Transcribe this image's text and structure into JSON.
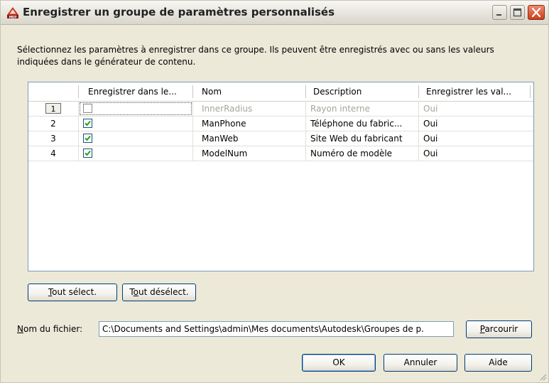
{
  "window": {
    "title": "Enregistrer un groupe de paramètres personnalisés",
    "app_icon": "autocad-mep-icon",
    "controls": [
      "minimize-icon",
      "maximize-icon",
      "close-icon"
    ]
  },
  "instructions": "Sélectionnez les paramètres à enregistrer dans ce groupe. Ils peuvent être enregistrés avec ou sans les valeurs indiquées dans le générateur de contenu.",
  "table": {
    "columns": [
      "",
      "Enregistrer dans le...",
      "Nom",
      "Description",
      "Enregistrer les val..."
    ],
    "rows": [
      {
        "num": "1",
        "checked": false,
        "name": "InnerRadius",
        "description": "Rayon interne",
        "save_value": "Oui",
        "disabled": true,
        "selected": true
      },
      {
        "num": "2",
        "checked": true,
        "name": "ManPhone",
        "description": "Téléphone du fabric...",
        "save_value": "Oui",
        "disabled": false,
        "selected": false
      },
      {
        "num": "3",
        "checked": true,
        "name": "ManWeb",
        "description": "Site Web du fabricant",
        "save_value": "Oui",
        "disabled": false,
        "selected": false
      },
      {
        "num": "4",
        "checked": true,
        "name": "ModelNum",
        "description": "Numéro de modèle",
        "save_value": "Oui",
        "disabled": false,
        "selected": false
      }
    ]
  },
  "buttons": {
    "select_all": {
      "accel": "T",
      "rest": "out sélect."
    },
    "deselect_all": {
      "pre": "T",
      "accel": "o",
      "rest": "ut désélect."
    },
    "browse": {
      "accel": "P",
      "rest": "arcourir"
    },
    "ok": "OK",
    "cancel": "Annuler",
    "help": "Aide"
  },
  "filename": {
    "label_accel": "N",
    "label_rest": "om du fichier:",
    "value": "C:\\Documents and Settings\\admin\\Mes documents\\Autodesk\\Groupes de p."
  },
  "colors": {
    "dialog_bg": "#ece9d8",
    "check_green": "#21a121",
    "border_blue": "#7f9db9",
    "close_red": "#c8401e"
  }
}
